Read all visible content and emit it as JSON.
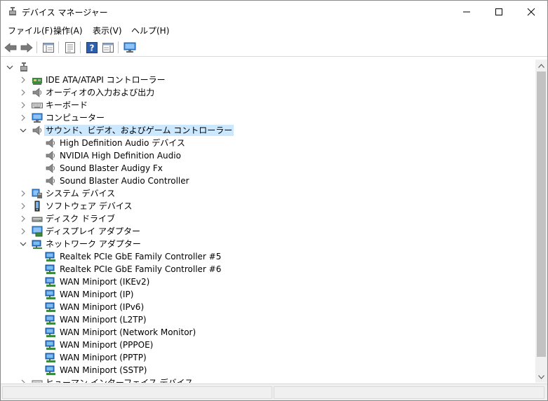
{
  "window": {
    "title": "デバイス マネージャー"
  },
  "menu": [
    {
      "label": "ファイル(F)"
    },
    {
      "label": "操作(A)"
    },
    {
      "label": "表示(V)"
    },
    {
      "label": "ヘルプ(H)"
    }
  ],
  "toolbar": {
    "buttons": [
      "back-arrow-icon",
      "forward-arrow-icon",
      "show-hide-tree-icon",
      "properties-icon",
      "help-icon",
      "action-pane-icon",
      "monitor-icon"
    ]
  },
  "tree": {
    "root": "",
    "categories": [
      {
        "label": "IDE ATA/ATAPI コントローラー",
        "icon": "ide-controller-icon",
        "expanded": false,
        "children": []
      },
      {
        "label": "オーディオの入力および出力",
        "icon": "speaker-icon",
        "expanded": false,
        "children": []
      },
      {
        "label": "キーボード",
        "icon": "keyboard-icon",
        "expanded": false,
        "children": []
      },
      {
        "label": "コンピューター",
        "icon": "computer-icon",
        "expanded": false,
        "children": []
      },
      {
        "label": "サウンド、ビデオ、およびゲーム コントローラー",
        "icon": "speaker-icon",
        "expanded": true,
        "selected": true,
        "children": [
          "High Definition Audio デバイス",
          "NVIDIA High Definition Audio",
          "Sound Blaster Audigy Fx",
          "Sound Blaster Audio Controller"
        ]
      },
      {
        "label": "システム デバイス",
        "icon": "system-device-icon",
        "expanded": false,
        "children": []
      },
      {
        "label": "ソフトウェア デバイス",
        "icon": "software-device-icon",
        "expanded": false,
        "children": []
      },
      {
        "label": "ディスク ドライブ",
        "icon": "disk-drive-icon",
        "expanded": false,
        "children": []
      },
      {
        "label": "ディスプレイ アダプター",
        "icon": "display-adapter-icon",
        "expanded": false,
        "children": []
      },
      {
        "label": "ネットワーク アダプター",
        "icon": "network-adapter-icon",
        "expanded": true,
        "children": [
          "Realtek PCIe GbE Family Controller #5",
          "Realtek PCIe GbE Family Controller #6",
          "WAN Miniport (IKEv2)",
          "WAN Miniport (IP)",
          "WAN Miniport (IPv6)",
          "WAN Miniport (L2TP)",
          "WAN Miniport (Network Monitor)",
          "WAN Miniport (PPPOE)",
          "WAN Miniport (PPTP)",
          "WAN Miniport (SSTP)"
        ]
      },
      {
        "label": "ヒューマン インターフェイス デバイス",
        "icon": "hid-icon",
        "expanded": false,
        "children": []
      }
    ]
  },
  "colors": {
    "selection": "#cce8ff",
    "network": "#2b7bd4",
    "scroll_thumb": "#c2c2c2"
  }
}
